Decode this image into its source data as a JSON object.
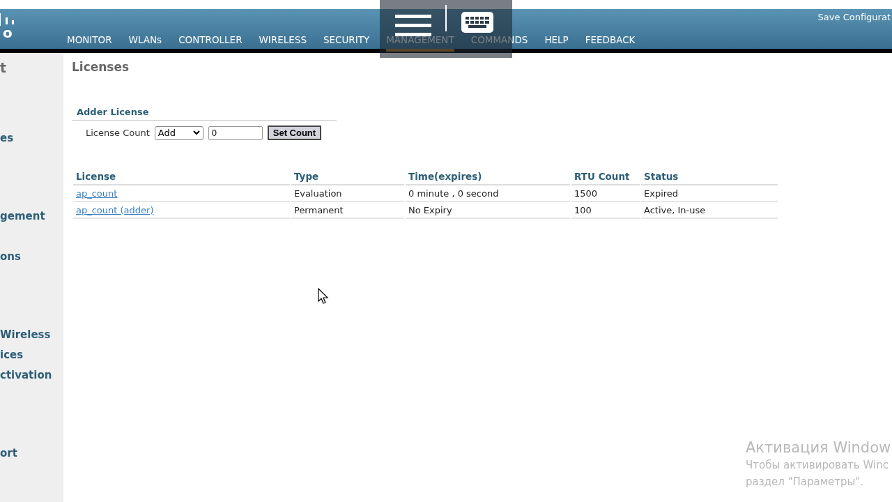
{
  "header": {
    "logo_text": "o",
    "save_link": "Save Configurat",
    "nav": [
      {
        "label": "MONITOR",
        "selected": false
      },
      {
        "label": "WLANs",
        "selected": false
      },
      {
        "label": "CONTROLLER",
        "selected": false
      },
      {
        "label": "WIRELESS",
        "selected": false
      },
      {
        "label": "SECURITY",
        "selected": false
      },
      {
        "label": "MANAGEMENT",
        "selected": true
      },
      {
        "label": "COMMANDS",
        "selected": false
      },
      {
        "label": "HELP",
        "selected": false
      },
      {
        "label": "FEEDBACK",
        "selected": false
      }
    ]
  },
  "sidebar": {
    "title": "t",
    "items": [
      {
        "label": "es"
      },
      {
        "label": "gement"
      },
      {
        "label": "ons"
      },
      {
        "label": "Wireless"
      },
      {
        "label": "ices"
      },
      {
        "label": "ctivation"
      },
      {
        "label": "ort"
      }
    ]
  },
  "page_title": "Licenses",
  "adder": {
    "title": "Adder License",
    "field_label": "License Count",
    "mode": "Add",
    "count": "0",
    "button": "Set Count"
  },
  "table": {
    "columns": [
      "License",
      "Type",
      "Time(expires)",
      "RTU Count",
      "Status"
    ],
    "rows": [
      [
        "ap_count",
        "Evaluation",
        "0 minute ,  0 second",
        "1500",
        "Expired"
      ],
      [
        "ap_count (adder)",
        "Permanent",
        "No Expiry",
        "100",
        "Active, In-use"
      ]
    ]
  },
  "windows_notice": {
    "title": "Активация Window",
    "lines": [
      "Чтобы активировать Winc",
      "раздел \"Параметры\"."
    ]
  }
}
